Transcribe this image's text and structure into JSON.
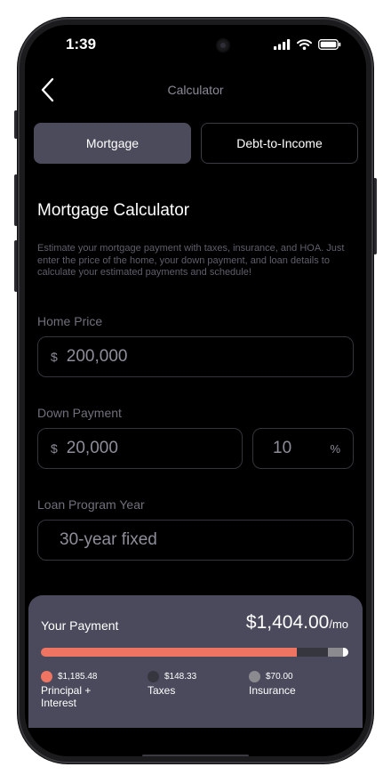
{
  "status_bar": {
    "time": "1:39"
  },
  "header": {
    "title": "Calculator"
  },
  "tabs": [
    {
      "label": "Mortgage",
      "active": true
    },
    {
      "label": "Debt-to-Income",
      "active": false
    }
  ],
  "calculator": {
    "title": "Mortgage Calculator",
    "description": "Estimate your mortgage payment with taxes, insurance, and HOA. Just enter the price of the home, your down payment, and loan details to calculate your estimated payments and schedule!"
  },
  "home_price": {
    "label": "Home Price",
    "currency": "$",
    "value": "200,000"
  },
  "down_payment": {
    "label": "Down Payment",
    "currency": "$",
    "value": "20,000",
    "percent_value": "10",
    "percent_symbol": "%"
  },
  "loan_program": {
    "label": "Loan Program Year",
    "value": "30-year fixed"
  },
  "payment": {
    "label": "Your Payment",
    "amount": "$1,404.00",
    "period": "/mo",
    "breakdown": [
      {
        "value": "$1,185.48",
        "name": "Principal + Interest",
        "color": "#f07462",
        "amount": 1185.48
      },
      {
        "value": "$148.33",
        "name": "Taxes",
        "color": "#36363f",
        "amount": 148.33
      },
      {
        "value": "$70.00",
        "name": "Insurance",
        "color": "#8a8a8f",
        "amount": 70.0
      }
    ],
    "remainder_color": "#ffffff",
    "remainder_amount": 0.19
  },
  "colors": {
    "accent": "#f07462",
    "card": "#4a4a5c",
    "active_tab": "#4b4b5c",
    "background": "#000000"
  }
}
